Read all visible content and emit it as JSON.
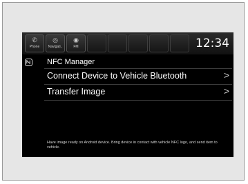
{
  "statusbar": {
    "buttons": [
      {
        "label": "Phone",
        "icon": "phone-icon",
        "glyph": "✆"
      },
      {
        "label": "Navigati..",
        "icon": "navigation-icon",
        "glyph": "◎"
      },
      {
        "label": "FM",
        "icon": "radio-icon",
        "glyph": "◉"
      }
    ],
    "clock": "12:34"
  },
  "header": {
    "logo_icon": "nfc-icon",
    "title": "NFC Manager"
  },
  "menu": {
    "items": [
      {
        "label": "Connect Device to Vehicle Bluetooth",
        "chevron": ">"
      },
      {
        "label": "Transfer Image",
        "chevron": ">"
      }
    ]
  },
  "footer": {
    "help": "Have image ready on Android device. Bring device in contact with vehicle NFC logo, and send item to vehicle."
  }
}
